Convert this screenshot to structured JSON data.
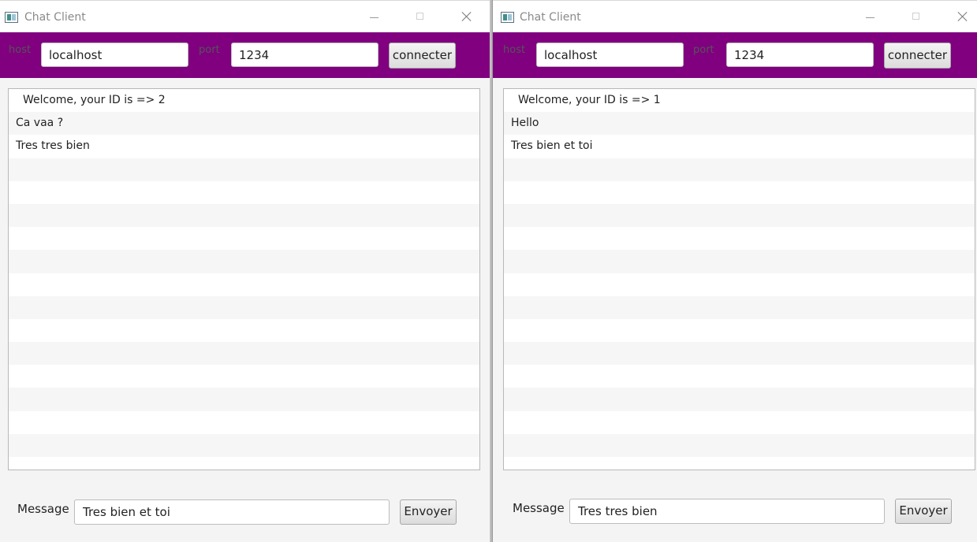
{
  "windows": [
    {
      "title": "Chat Client",
      "host_label": "host",
      "host_value": "localhost",
      "port_label": "port",
      "port_value": "1234",
      "connect_label": "connecter",
      "messages": [
        "Welcome, your ID is => 2",
        "Ca vaa ?",
        "Tres tres bien"
      ],
      "message_label": "Message",
      "message_value": "Tres bien et toi",
      "send_label": "Envoyer"
    },
    {
      "title": "Chat Client",
      "host_label": "host",
      "host_value": "localhost",
      "port_label": "port",
      "port_value": "1234",
      "connect_label": "connecter",
      "messages": [
        "Welcome, your ID is => 1",
        "Hello",
        "Tres bien et toi"
      ],
      "message_label": "Message",
      "message_value": "Tres tres bien",
      "send_label": "Envoyer"
    }
  ],
  "colors": {
    "toolbar_bg": "#800080",
    "window_bg": "#f4f4f4",
    "list_stripe": "#f6f6f6"
  },
  "icons": [
    "app-icon",
    "minimize-icon",
    "maximize-icon",
    "close-icon"
  ]
}
